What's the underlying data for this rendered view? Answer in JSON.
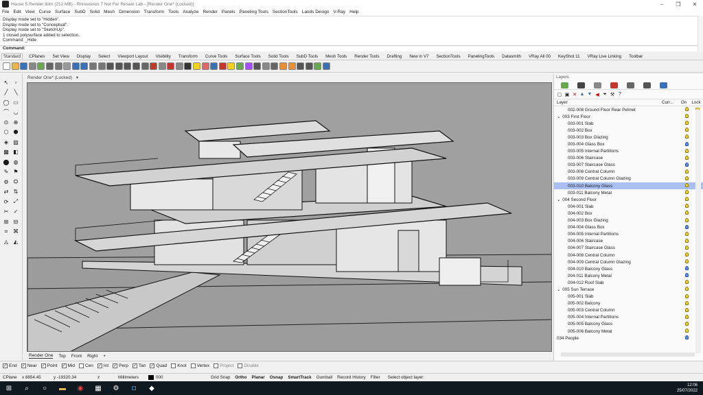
{
  "window": {
    "title": "House 5 Render.3dm (212 MB) - Rhinoceros 7 Not For Resale Lab - [Render One* (Locked)]",
    "minimize": "–",
    "restore": "❐",
    "close": "✕"
  },
  "menu": [
    "File",
    "Edit",
    "View",
    "Curve",
    "Surface",
    "SubD",
    "Solid",
    "Mesh",
    "Dimension",
    "Transform",
    "Tools",
    "Analyze",
    "Render",
    "Panels",
    "Paneling Tools",
    "SectionTools",
    "Lands Design",
    "V-Ray",
    "Help"
  ],
  "command_history": [
    "Display mode set to \"Hidden\".",
    "Display mode set to \"Conceptual\".",
    "Display mode set to \"SketchUp\".",
    "1 closed polysurface added to selection.",
    "Command: _Hide"
  ],
  "command_prompt": "Command:",
  "toolbar_tabs": [
    "Standard",
    "CPlanes",
    "Set View",
    "Display",
    "Select",
    "Viewport Layout",
    "Visibility",
    "Transform",
    "Curve Tools",
    "Surface Tools",
    "Solid Tools",
    "SubD Tools",
    "Mesh Tools",
    "Render Tools",
    "Drafting",
    "New in V7",
    "SectionTools",
    "PanelingTools",
    "Datasmith",
    "VRay All 00",
    "KeyShot 11",
    "VRay Live Linking",
    "Toolbar"
  ],
  "active_tab": "Standard",
  "viewport": {
    "title": "Render One* (Locked)",
    "title_arrow": "▾",
    "tabs": [
      "Render One",
      "Top",
      "Front",
      "Right"
    ],
    "add_tab": "+"
  },
  "layers_panel": {
    "title": "Layers",
    "columns": {
      "layer": "Layer",
      "current": "Curr...",
      "on": "On",
      "lock": "Lock"
    },
    "rows": [
      {
        "name": "002-008 Ground Floor Rear Pelmet",
        "indent": 2,
        "bulb": "yellow"
      },
      {
        "name": "003 First Floor",
        "indent": 1,
        "group": true,
        "bulb": "yellow"
      },
      {
        "name": "003-001 Slab",
        "indent": 2,
        "bulb": "yellow"
      },
      {
        "name": "003-002 Box",
        "indent": 2,
        "bulb": "yellow"
      },
      {
        "name": "003-003 Box Glazing",
        "indent": 2,
        "bulb": "yellow"
      },
      {
        "name": "003-004 Glass Box",
        "indent": 2,
        "bulb": "blue"
      },
      {
        "name": "003-005 Internal Partitions",
        "indent": 2,
        "bulb": "yellow"
      },
      {
        "name": "003-006 Staircase",
        "indent": 2,
        "bulb": "yellow"
      },
      {
        "name": "003-007 Staircase Glass",
        "indent": 2,
        "bulb": "blue"
      },
      {
        "name": "003-008 Central Column",
        "indent": 2,
        "bulb": "yellow"
      },
      {
        "name": "003-009 Central Column Glazing",
        "indent": 2,
        "bulb": "yellow"
      },
      {
        "name": "003-010 Balcony Glass",
        "indent": 2,
        "bulb": "yellow",
        "selected": true
      },
      {
        "name": "003-011 Balcony Metal",
        "indent": 2,
        "bulb": "yellow"
      },
      {
        "name": "004 Second Floor",
        "indent": 1,
        "group": true,
        "bulb": "yellow"
      },
      {
        "name": "004-001 Slab",
        "indent": 2,
        "bulb": "yellow"
      },
      {
        "name": "004-002 Box",
        "indent": 2,
        "bulb": "yellow"
      },
      {
        "name": "004-003 Box Glazing",
        "indent": 2,
        "bulb": "yellow"
      },
      {
        "name": "004-004 Glass Box",
        "indent": 2,
        "bulb": "blue"
      },
      {
        "name": "004-005 Internal Partitions",
        "indent": 2,
        "bulb": "yellow"
      },
      {
        "name": "004-006 Staircase",
        "indent": 2,
        "bulb": "yellow"
      },
      {
        "name": "004-007 Staircase Glass",
        "indent": 2,
        "bulb": "yellow"
      },
      {
        "name": "004-008 Central Column",
        "indent": 2,
        "bulb": "yellow"
      },
      {
        "name": "004-009 Central Column Glazing",
        "indent": 2,
        "bulb": "yellow"
      },
      {
        "name": "004-010 Balcony Glass",
        "indent": 2,
        "bulb": "blue"
      },
      {
        "name": "004-011 Balcony Metal",
        "indent": 2,
        "bulb": "blue"
      },
      {
        "name": "004-012 Roof Slab",
        "indent": 2,
        "bulb": "yellow"
      },
      {
        "name": "005 Sun Terrace",
        "indent": 1,
        "group": true,
        "bulb": "yellow"
      },
      {
        "name": "005-001 Slab",
        "indent": 2,
        "bulb": "yellow"
      },
      {
        "name": "005-002 Balcony",
        "indent": 2,
        "bulb": "yellow"
      },
      {
        "name": "005-003 Central Column",
        "indent": 2,
        "bulb": "yellow"
      },
      {
        "name": "005-004 Internal Partitions",
        "indent": 2,
        "bulb": "yellow"
      },
      {
        "name": "005-005 Balcony Glass",
        "indent": 2,
        "bulb": "yellow"
      },
      {
        "name": "005-006 Balcony Metal",
        "indent": 2,
        "bulb": "yellow"
      },
      {
        "name": "034 People",
        "indent": 1,
        "bulb": "blue"
      }
    ]
  },
  "osnap": [
    {
      "label": "End",
      "checked": true,
      "disabled": false
    },
    {
      "label": "Near",
      "checked": true,
      "disabled": false
    },
    {
      "label": "Point",
      "checked": true,
      "disabled": false
    },
    {
      "label": "Mid",
      "checked": true,
      "disabled": false
    },
    {
      "label": "Cen",
      "checked": false,
      "disabled": false
    },
    {
      "label": "Int",
      "checked": true,
      "disabled": false
    },
    {
      "label": "Perp",
      "checked": true,
      "disabled": false
    },
    {
      "label": "Tan",
      "checked": true,
      "disabled": false
    },
    {
      "label": "Quad",
      "checked": true,
      "disabled": false
    },
    {
      "label": "Knot",
      "checked": false,
      "disabled": false
    },
    {
      "label": "Vertex",
      "checked": false,
      "disabled": false
    },
    {
      "label": "Project",
      "checked": false,
      "disabled": true
    },
    {
      "label": "Disable",
      "checked": false,
      "disabled": true
    }
  ],
  "status": {
    "cplane": "CPlane",
    "x": "x 8854.45",
    "y": "y -19320.34",
    "z": "z",
    "units": "Millimeters",
    "layer_swatch": "000",
    "toggles": [
      "Grid Snap",
      "Ortho",
      "Planar",
      "Osnap",
      "SmartTrack",
      "Gumball",
      "Record History",
      "Filter"
    ],
    "bold_toggles": [
      "Ortho",
      "Planar",
      "Osnap",
      "SmartTrack"
    ],
    "message": "Select object layer:"
  },
  "taskbar": {
    "time": "12:06",
    "date": "25/07/2022"
  },
  "colors": {
    "selected_row": "#a9bff2",
    "viewport_bg": "#9a9a9a",
    "taskbar": "#101820"
  }
}
